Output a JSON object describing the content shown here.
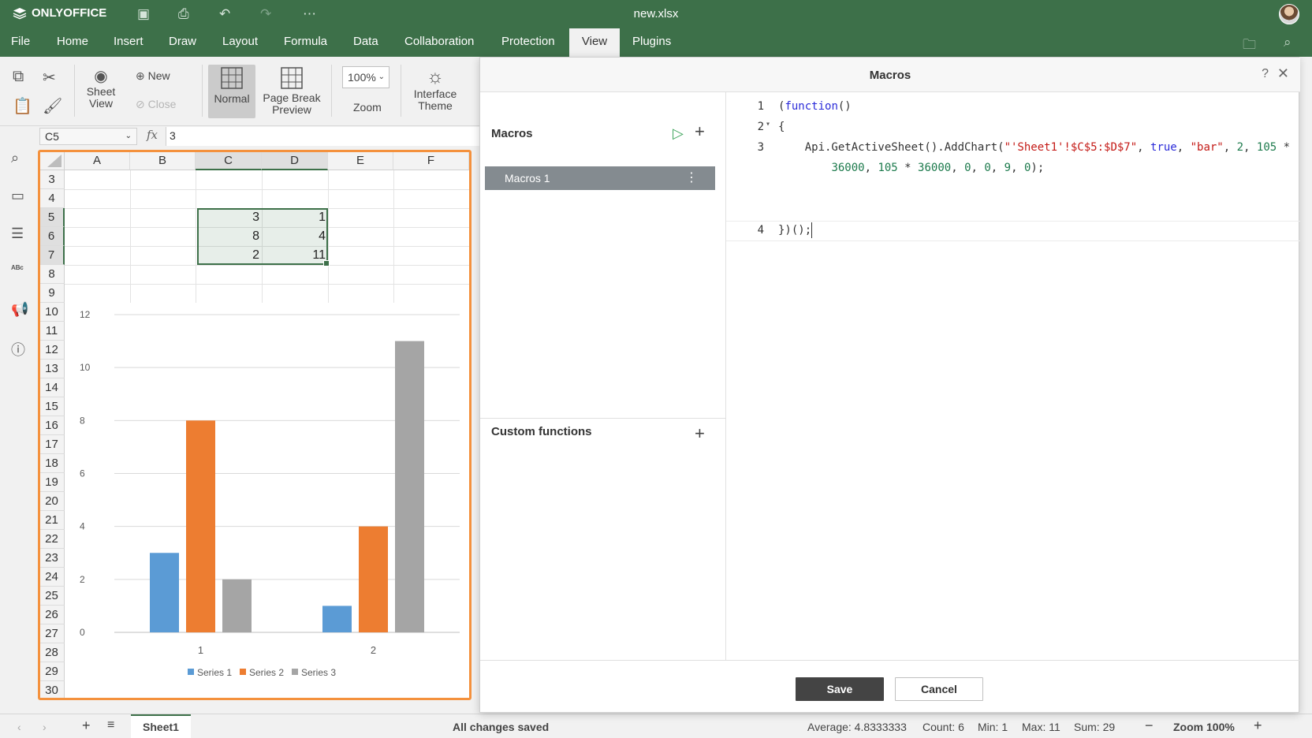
{
  "app": {
    "brand": "ONLYOFFICE",
    "doc_title": "new.xlsx"
  },
  "menu": {
    "tabs": [
      "File",
      "Home",
      "Insert",
      "Draw",
      "Layout",
      "Formula",
      "Data",
      "Collaboration",
      "Protection",
      "View",
      "Plugins"
    ],
    "active_tab": "View"
  },
  "toolbar": {
    "sheet_view": "Sheet View",
    "new": "New",
    "close": "Close",
    "normal": "Normal",
    "page_break_preview": "Page Break Preview",
    "zoom_value": "100%",
    "zoom": "Zoom",
    "interface_theme": "Interface Theme"
  },
  "formula_bar": {
    "cell_ref": "C5",
    "fx": "fx",
    "value": "3"
  },
  "sheet": {
    "columns": [
      "A",
      "B",
      "C",
      "D",
      "E",
      "F"
    ],
    "rows": [
      "3",
      "4",
      "5",
      "6",
      "7",
      "8",
      "9",
      "10",
      "11",
      "12",
      "13",
      "14",
      "15",
      "16",
      "17",
      "18",
      "19",
      "20",
      "21",
      "22",
      "23",
      "24",
      "25",
      "26",
      "27",
      "28",
      "29",
      "30"
    ],
    "cells": {
      "c5": "3",
      "d5": "1",
      "c6": "8",
      "d6": "4",
      "c7": "2",
      "d7": "11"
    }
  },
  "chart_data": {
    "type": "bar",
    "categories": [
      "1",
      "2"
    ],
    "series": [
      {
        "name": "Series 1",
        "values": [
          3,
          1
        ],
        "color": "#5b9bd5"
      },
      {
        "name": "Series 2",
        "values": [
          8,
          4
        ],
        "color": "#ed7d31"
      },
      {
        "name": "Series 3",
        "values": [
          2,
          11
        ],
        "color": "#a5a5a5"
      }
    ],
    "ylim": [
      0,
      12
    ],
    "yticks": [
      0,
      2,
      4,
      6,
      8,
      10,
      12
    ],
    "grid": true,
    "legend": "bottom"
  },
  "status": {
    "sheet_tab": "Sheet1",
    "saved": "All changes saved",
    "average": "Average: 4.8333333",
    "count": "Count: 6",
    "min": "Min: 1",
    "max": "Max: 11",
    "sum": "Sum: 29",
    "zoom": "Zoom 100%"
  },
  "dialog": {
    "title": "Macros",
    "help": "?",
    "macros_label": "Macros",
    "macro_item": "Macros 1",
    "custom_functions_label": "Custom functions",
    "code_lines": {
      "l1_num": "1",
      "l2_num": "2",
      "l3_num": "3",
      "l4_num": "4",
      "l1": "(function()",
      "l2": "{",
      "l3a_pre": "    Api.GetActiveSheet().AddChart(",
      "l3a_str1": "\"'Sheet1'!$C$5:$D$7\"",
      "l3a_sep1": ", ",
      "l3a_kw": "true",
      "l3a_sep2": ", ",
      "l3a_str2": "\"bar\"",
      "l3a_sep3": ", ",
      "l3a_n1": "2",
      "l3a_sep4": ", ",
      "l3a_n2": "105",
      "l3a_tail": " *",
      "l3b_pre": "        ",
      "l3b_n1": "36000",
      "l3b_s1": ", ",
      "l3b_n2": "105",
      "l3b_s2": " * ",
      "l3b_n3": "36000",
      "l3b_s3": ", ",
      "l3b_n4": "0",
      "l3b_s4": ", ",
      "l3b_n5": "0",
      "l3b_s5": ", ",
      "l3b_n6": "9",
      "l3b_s6": ", ",
      "l3b_n7": "0",
      "l3b_end": ");",
      "l4": "})();"
    },
    "save": "Save",
    "cancel": "Cancel"
  }
}
